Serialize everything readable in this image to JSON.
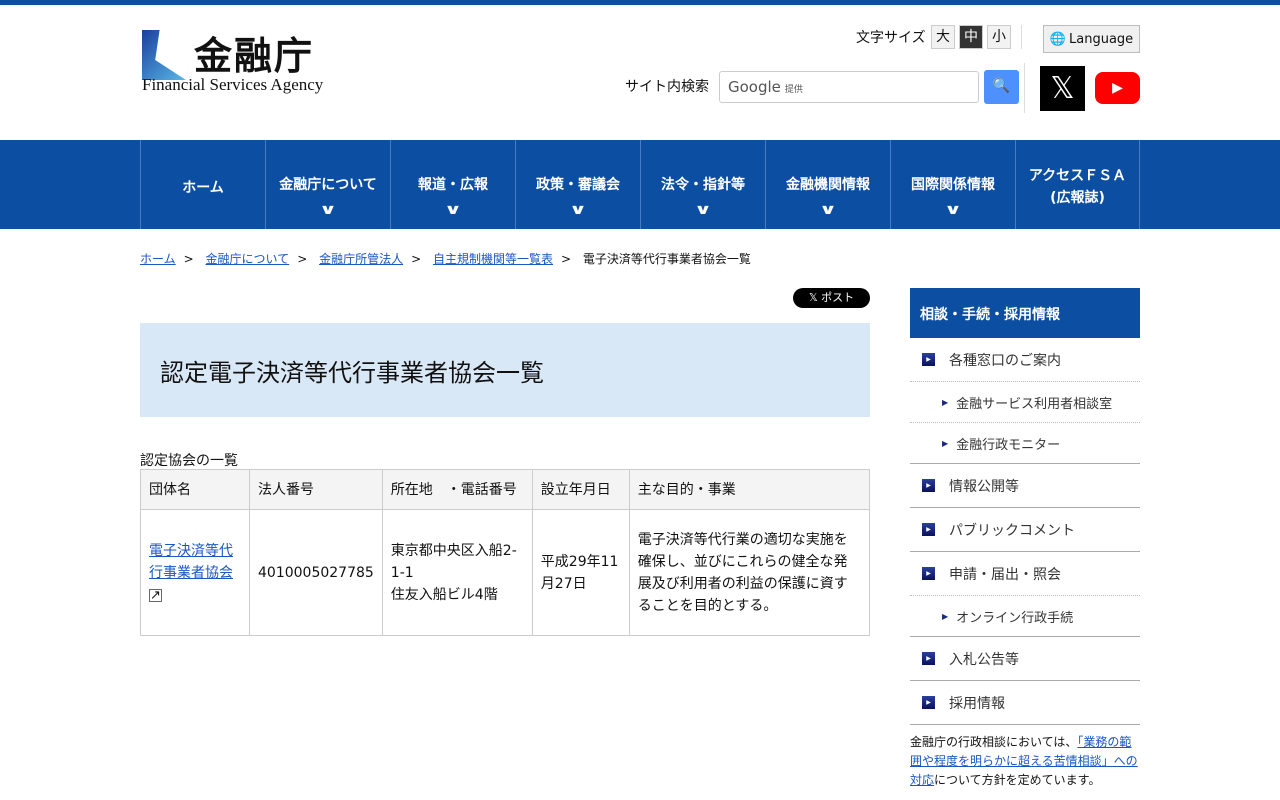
{
  "header": {
    "logo_kanji": "金融庁",
    "logo_en": "Financial Services Agency",
    "font_size_label": "文字サイズ",
    "font_sizes": [
      "大",
      "中",
      "小"
    ],
    "language": "Language",
    "search_label": "サイト内検索",
    "search_placeholder_brand": "Google",
    "search_placeholder_suffix": "提供"
  },
  "nav": [
    {
      "label": "ホーム",
      "chev": false
    },
    {
      "label": "金融庁について",
      "chev": true
    },
    {
      "label": "報道・広報",
      "chev": true
    },
    {
      "label": "政策・審議会",
      "chev": true
    },
    {
      "label": "法令・指針等",
      "chev": true
    },
    {
      "label": "金融機関情報",
      "chev": true
    },
    {
      "label": "国際関係情報",
      "chev": true
    },
    {
      "label": "アクセスＦＳＡ",
      "label2": "(広報誌)",
      "chev": false
    }
  ],
  "breadcrumb": [
    "ホーム",
    "金融庁について",
    "金融庁所管法人",
    "自主規制機関等一覧表",
    "電子決済等代行事業者協会一覧"
  ],
  "post_label": "ポスト",
  "page_title": "認定電子決済等代行事業者協会一覧",
  "table": {
    "caption": "認定協会の一覧",
    "headers": [
      "団体名",
      "法人番号",
      "所在地　・電話番号",
      "設立年月日",
      "主な目的・事業"
    ],
    "rows": [
      {
        "name": "電子決済等代行事業者協会",
        "number": "4010005027785",
        "address1": "東京都中央区入船2-1-1",
        "address2": "住友入船ビル4階",
        "date": "平成29年11月27日",
        "purpose": "電子決済等代行業の適切な実施を確保し、並びにこれらの健全な発展及び利用者の利益の保護に資することを目的とする。"
      }
    ]
  },
  "sidebar": {
    "heading": "相談・手続・採用情報",
    "items": [
      {
        "label": "各種窓口のご案内",
        "subs": [
          "金融サービス利用者相談室",
          "金融行政モニター"
        ]
      },
      {
        "label": "情報公開等",
        "subs": []
      },
      {
        "label": "パブリックコメント",
        "subs": []
      },
      {
        "label": "申請・届出・照会",
        "subs": [
          "オンライン行政手続"
        ]
      },
      {
        "label": "入札公告等",
        "subs": []
      },
      {
        "label": "採用情報",
        "subs": []
      }
    ],
    "note_pre": "金融庁の行政相談においては、",
    "note_link": "「業務の範囲や程度を明らかに超える苦情相談」への対応",
    "note_post": "について方針を定めています。"
  },
  "colors": {
    "brand": "#0b4ea2",
    "title_bg": "#d9e8f6"
  }
}
